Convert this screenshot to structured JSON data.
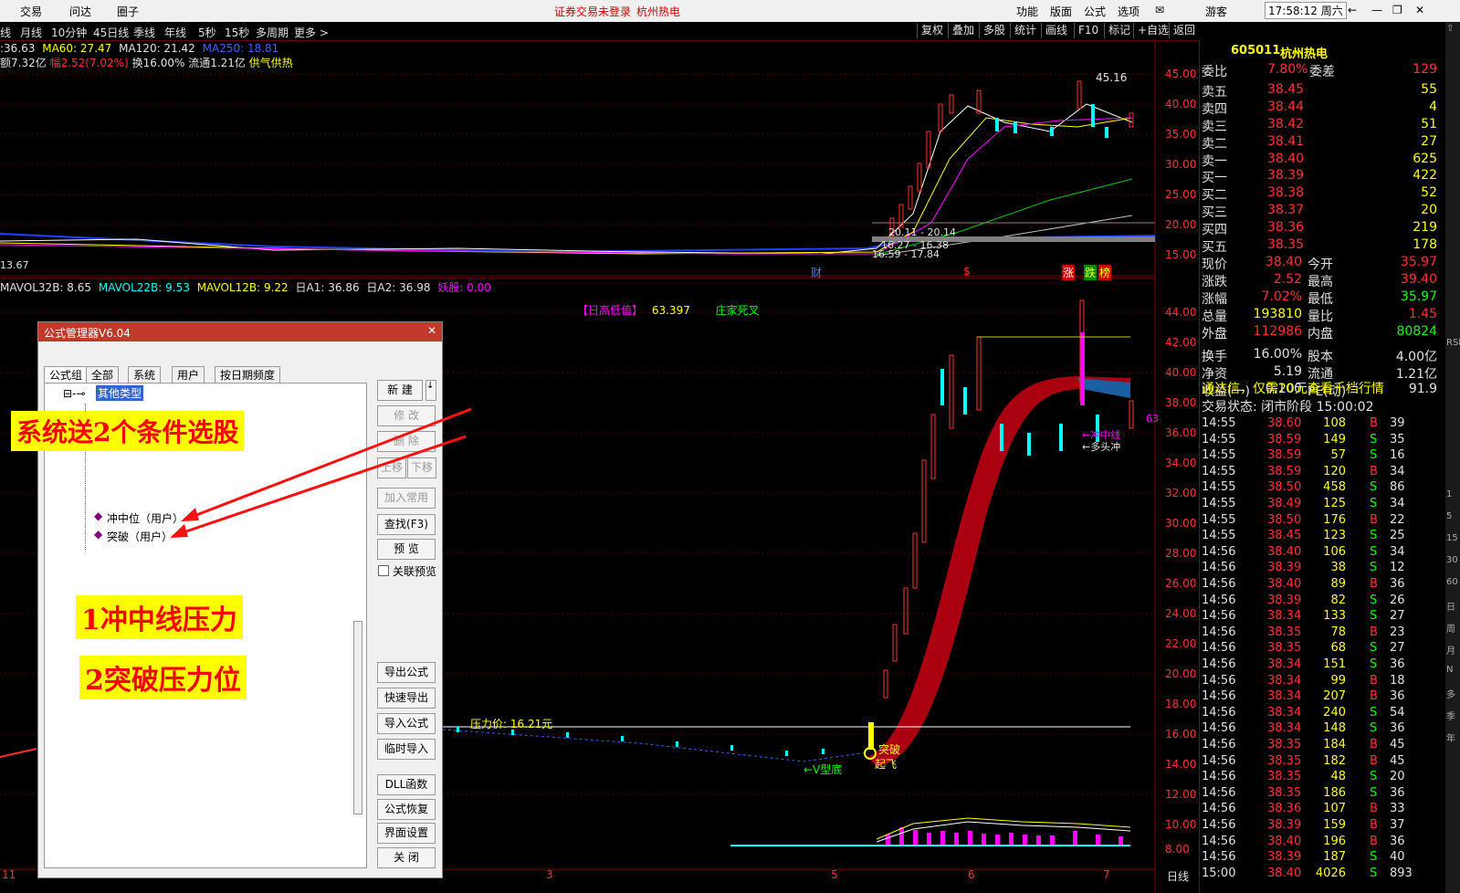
{
  "topbar": {
    "menu_left": [
      "交易",
      "问达",
      "圈子"
    ],
    "notice": "证券交易未登录",
    "stock_name": "杭州热电",
    "menu_right": [
      "功能",
      "版面",
      "公式",
      "选项"
    ],
    "user": "游客",
    "clock": "17:58:12 周六"
  },
  "periodbar": {
    "periods": [
      "线",
      "月线",
      "10分钟",
      "45日线",
      "季线",
      "年线",
      "5秒",
      "15秒",
      "多周期",
      "更多 >"
    ],
    "tools": [
      "复权",
      "叠加",
      "多股",
      "统计",
      "画线",
      "F10",
      "标记",
      "+自选",
      "返回"
    ]
  },
  "indicators": {
    "ma_line": [
      ":36.63",
      "MA60: 27.47",
      "MA120: 21.42",
      "MA250: 18.81"
    ],
    "info_line": [
      "额7.32亿",
      "幅2.52(7.02%)",
      "换16.00%",
      "流通1.21亿",
      "供气供热"
    ],
    "sub_line": [
      "MAVOL32B: 8.65",
      "MAVOL22B: 9.53",
      "MAVOL12B: 9.22",
      "日A1: 36.86",
      "日A2: 36.98",
      "妖股: 0.00"
    ],
    "sub_labels": [
      "【日高低值】",
      "63.397",
      "庄家死叉"
    ],
    "main_annotations": [
      "45.16",
      "20.11 - 20.14",
      "16.27 - 16.38",
      "16.59 - 17.84",
      "13.67"
    ],
    "event_labels": [
      "财",
      "$",
      "涨",
      "跌",
      "榜"
    ],
    "bottom_annotations": [
      "压力价: 16.21元",
      "突破",
      "起飞",
      "←V型底",
      "←冲中线",
      "←多头冲"
    ]
  },
  "axis": {
    "upper": [
      "45.00",
      "40.00",
      "35.00",
      "30.00",
      "25.00",
      "20.00",
      "15.00"
    ],
    "lower": [
      "44.00",
      "42.00",
      "40.00",
      "38.00",
      "36.00",
      "34.00",
      "32.00",
      "30.00",
      "28.00",
      "26.00",
      "24.00",
      "22.00",
      "20.00",
      "18.00",
      "16.00",
      "14.00",
      "12.00",
      "10.00",
      "8.00"
    ],
    "x_labels": [
      "11",
      "3",
      "5",
      "6",
      "7"
    ],
    "right_clip": "63"
  },
  "quote": {
    "header": {
      "code": "605011",
      "name": "杭州热电"
    },
    "weibi": {
      "label": "委比",
      "value": "7.80%",
      "label2": "委差",
      "value2": "129"
    },
    "asks": [
      {
        "label": "卖五",
        "price": "38.45",
        "vol": "55"
      },
      {
        "label": "卖四",
        "price": "38.44",
        "vol": "4"
      },
      {
        "label": "卖三",
        "price": "38.42",
        "vol": "51"
      },
      {
        "label": "卖二",
        "price": "38.41",
        "vol": "27"
      },
      {
        "label": "卖一",
        "price": "38.40",
        "vol": "625"
      }
    ],
    "bids": [
      {
        "label": "买一",
        "price": "38.39",
        "vol": "422"
      },
      {
        "label": "买二",
        "price": "38.38",
        "vol": "52"
      },
      {
        "label": "买三",
        "price": "38.37",
        "vol": "20"
      },
      {
        "label": "买四",
        "price": "38.36",
        "vol": "219"
      },
      {
        "label": "买五",
        "price": "38.35",
        "vol": "178"
      }
    ],
    "stats": [
      {
        "l1": "现价",
        "v1": "38.40",
        "l2": "今开",
        "v2": "35.97"
      },
      {
        "l1": "涨跌",
        "v1": "2.52",
        "l2": "最高",
        "v2": "39.40"
      },
      {
        "l1": "涨幅",
        "v1": "7.02%",
        "l2": "最低",
        "v2": "35.97"
      },
      {
        "l1": "总量",
        "v1": "193810",
        "l2": "量比",
        "v2": "1.45"
      },
      {
        "l1": "外盘",
        "v1": "112986",
        "l2": "内盘",
        "v2": "80824"
      },
      {
        "l1": "换手",
        "v1": "16.00%",
        "l2": "股本",
        "v2": "4.00亿"
      },
      {
        "l1": "净资",
        "v1": "5.19",
        "l2": "流通",
        "v2": "1.21亿"
      },
      {
        "l1": "收益(一)",
        "v1": "0.100",
        "l2": "PE(动)",
        "v2": "91.9"
      }
    ],
    "ad": "通达信，仅需20元查看千档行情",
    "status": "交易状态: 闭市阶段 15:00:02",
    "ticks": [
      [
        "14:55",
        "38.60",
        "108",
        "B",
        "39"
      ],
      [
        "14:55",
        "38.59",
        "149",
        "S",
        "35"
      ],
      [
        "14:55",
        "38.59",
        "57",
        "S",
        "16"
      ],
      [
        "14:55",
        "38.59",
        "120",
        "B",
        "34"
      ],
      [
        "14:55",
        "38.50",
        "458",
        "S",
        "86"
      ],
      [
        "14:55",
        "38.49",
        "125",
        "S",
        "34"
      ],
      [
        "14:55",
        "38.50",
        "176",
        "B",
        "22"
      ],
      [
        "14:55",
        "38.45",
        "123",
        "S",
        "25"
      ],
      [
        "14:56",
        "38.40",
        "106",
        "S",
        "34"
      ],
      [
        "14:56",
        "38.39",
        "38",
        "S",
        "12"
      ],
      [
        "14:56",
        "38.40",
        "89",
        "B",
        "36"
      ],
      [
        "14:56",
        "38.39",
        "82",
        "S",
        "26"
      ],
      [
        "14:56",
        "38.34",
        "133",
        "S",
        "27"
      ],
      [
        "14:56",
        "38.35",
        "78",
        "B",
        "23"
      ],
      [
        "14:56",
        "38.35",
        "68",
        "S",
        "27"
      ],
      [
        "14:56",
        "38.34",
        "151",
        "S",
        "36"
      ],
      [
        "14:56",
        "38.34",
        "99",
        "B",
        "18"
      ],
      [
        "14:56",
        "38.34",
        "207",
        "B",
        "36"
      ],
      [
        "14:56",
        "38.34",
        "240",
        "S",
        "54"
      ],
      [
        "14:56",
        "38.34",
        "148",
        "S",
        "36"
      ],
      [
        "14:56",
        "38.35",
        "184",
        "B",
        "45"
      ],
      [
        "14:56",
        "38.35",
        "182",
        "B",
        "45"
      ],
      [
        "14:56",
        "38.35",
        "48",
        "S",
        "20"
      ],
      [
        "14:56",
        "38.35",
        "186",
        "S",
        "36"
      ],
      [
        "14:56",
        "38.36",
        "107",
        "B",
        "33"
      ],
      [
        "14:56",
        "38.39",
        "159",
        "B",
        "37"
      ],
      [
        "14:56",
        "38.40",
        "196",
        "B",
        "36"
      ],
      [
        "14:56",
        "38.39",
        "187",
        "S",
        "40"
      ]
    ],
    "last_row": [
      "15:00",
      "38.40",
      "4026",
      "S",
      "893"
    ]
  },
  "sidebar_labels": [
    "RSI",
    "1",
    "5",
    "15",
    "30",
    "60",
    "日",
    "周",
    "月",
    "N",
    "多",
    "季",
    "年"
  ],
  "dialog": {
    "title": "公式管理器V6.04",
    "close": "✕",
    "tabs": [
      "公式组",
      "全部",
      "系统",
      "用户",
      "按日期频度"
    ],
    "tree_root": "其他类型",
    "tree_items": [
      "冲中位（用户）",
      "突破（用户）"
    ],
    "buttons_top": [
      "新 建",
      "修 改",
      "删 除",
      "上移",
      "下移",
      "加入常用",
      "查找(F3)",
      "预 览"
    ],
    "checkbox_label": "关联预览",
    "buttons_bottom": [
      "导出公式",
      "快速导出",
      "导入公式",
      "临时导入",
      "DLL函数",
      "公式恢复",
      "界面设置",
      "关 闭"
    ]
  },
  "callouts": {
    "main": "系统送2个条件选股",
    "item1": "1冲中线压力",
    "item2": "2突破压力位"
  },
  "bottom_period": "日线",
  "colors": {
    "up": "#ff3030",
    "down": "#00ffff",
    "ma_white": "#ffffff",
    "ma_yellow": "#ffff00",
    "ma_magenta": "#ff00ff",
    "ma_green": "#00cc00",
    "band": "#aa0010",
    "accent_title": "#c0392b"
  }
}
